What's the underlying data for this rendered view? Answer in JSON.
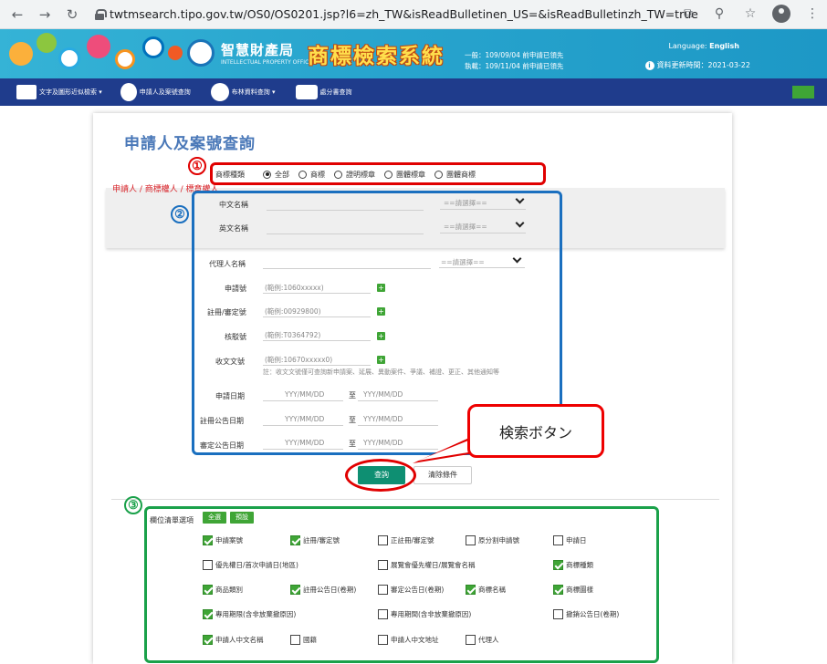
{
  "browser": {
    "url": "twtmsearch.tipo.gov.tw/OS0/OS0201.jsp?l6=zh_TW&isReadBulletinen_US=&isReadBulletinzh_TW=true"
  },
  "header": {
    "agency": "智慧財產局",
    "agency_en": "INTELLECTUAL PROPERTY OFFICE",
    "system_title": "商標檢索系統",
    "info_line1": "一般：109/09/04 前申請已領先",
    "info_line2": "執載：109/11/04 前申請已領先",
    "language_label": "Language:",
    "language_value": "English",
    "update_label": "資料更新時間：2021-03-22"
  },
  "nav": {
    "items": [
      "文字及圖形近似檢索 ▾",
      "申請人及案號查詢",
      "布林資料查詢 ▾",
      "處分書查詢"
    ]
  },
  "page": {
    "title": "申請人及案號查詢",
    "applicant_section": "申請人 / 商標權人 / 標章權人"
  },
  "trademark_type": {
    "label": "商標種類",
    "options": [
      "全部",
      "商標",
      "證明標章",
      "團體標章",
      "團體商標"
    ],
    "selected": 0
  },
  "form": {
    "chinese_name": "中文名稱",
    "english_name": "英文名稱",
    "select_placeholder": "==請選擇==",
    "agent_name": "代理人名稱",
    "application_no": "申請號",
    "application_ph": "(範例:1060xxxxx)",
    "registration_no": "註冊/審定號",
    "registration_ph": "(範例:00929800)",
    "revocation_no": "核駁號",
    "revocation_ph": "(範例:T0364792)",
    "receipt_no": "收文文號",
    "receipt_ph": "(範例:10670xxxxx0)",
    "receipt_note": "註：收文文號僅可查詢新申請案、延展、異動案件、爭議、補證、更正、其他通知等",
    "app_date": "申請日期",
    "reg_pub_date": "註冊公告日期",
    "exam_pub_date": "審定公告日期",
    "date_ph": "YYY/MM/DD",
    "to": "至"
  },
  "buttons": {
    "search": "查詢",
    "clear": "清除條件"
  },
  "annotations": {
    "n1": "①",
    "n2": "②",
    "n3": "③",
    "callout": "検索ボタン"
  },
  "columns": {
    "label": "欄位清單選項",
    "all": "全選",
    "default": "預設",
    "rows": [
      [
        {
          "t": "申請案號",
          "on": true
        },
        {
          "t": "註冊/審定號",
          "on": true
        },
        {
          "t": "正註冊/審定號",
          "on": false
        },
        {
          "t": "原分割申請號",
          "on": false
        },
        {
          "t": "申請日",
          "on": false
        }
      ],
      [
        {
          "t": "優先權日/首次申請日(地區)",
          "on": false
        },
        {
          "t": "展覽會優先權日/展覽會名稱",
          "on": false
        },
        {
          "t": "商標種類",
          "on": true
        }
      ],
      [
        {
          "t": "商品類別",
          "on": true
        },
        {
          "t": "註冊公告日(卷期)",
          "on": true
        },
        {
          "t": "審定公告日(卷期)",
          "on": false
        },
        {
          "t": "商標名稱",
          "on": true
        },
        {
          "t": "商標圖樣",
          "on": true
        }
      ],
      [
        {
          "t": "專用期限(含非放棄撤原因)",
          "on": true
        },
        {
          "t": "專用期間(含非放棄撤原因)",
          "on": false
        },
        {
          "t": "撤銷公告日(卷期)",
          "on": false
        }
      ],
      [
        {
          "t": "申請人中文名稱",
          "on": true
        },
        {
          "t": "國籍",
          "on": false
        },
        {
          "t": "申請人中文地址",
          "on": false
        },
        {
          "t": "代理人",
          "on": false
        }
      ]
    ]
  },
  "colors": {
    "red_box": "#e00000",
    "blue_box": "#1a6fbf",
    "green_box": "#1aa14a",
    "accent_green": "#3fa536"
  }
}
